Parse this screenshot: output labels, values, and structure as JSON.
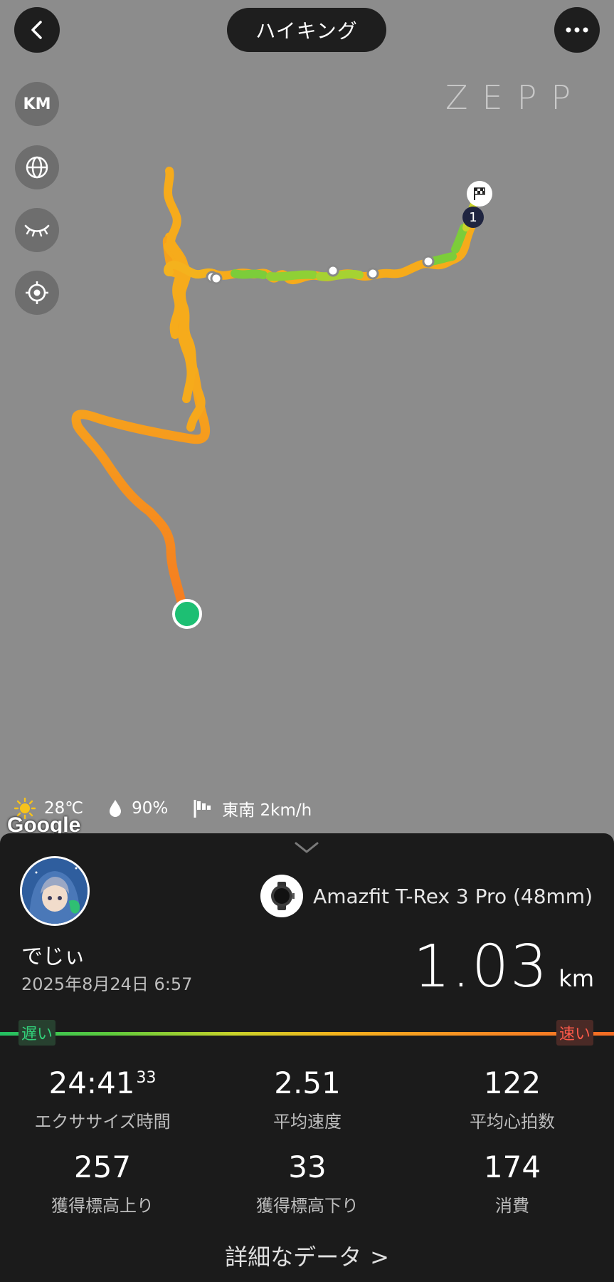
{
  "header": {
    "title": "ハイキング"
  },
  "map": {
    "unit_button": "KM",
    "brand": "ZEPP",
    "lap_marker": "1",
    "attribution": "Google"
  },
  "weather": {
    "temperature": "28℃",
    "humidity": "90%",
    "wind": "東南 2km/h"
  },
  "summary": {
    "username": "でじぃ",
    "datetime": "2025年8月24日 6:57",
    "device": "Amazfit T-Rex 3 Pro (48mm)",
    "distance": "1.03",
    "distance_unit": "km"
  },
  "speed_legend": {
    "slow": "遅い",
    "fast": "速い"
  },
  "stats": [
    {
      "value": "24:41",
      "value_sup": "33",
      "label": "エクササイズ時間"
    },
    {
      "value": "2.51",
      "label": "平均速度"
    },
    {
      "value": "122",
      "label": "平均心拍数"
    },
    {
      "value": "257",
      "label": "獲得標高上り"
    },
    {
      "value": "33",
      "label": "獲得標高下り"
    },
    {
      "value": "174",
      "label": "消費"
    }
  ],
  "details_link": "詳細なデータ",
  "colors": {
    "route_slow": "#5ecb3c",
    "route_mid": "#f4b21d",
    "route_fast": "#f36b24",
    "start_marker": "#1dbf73"
  }
}
